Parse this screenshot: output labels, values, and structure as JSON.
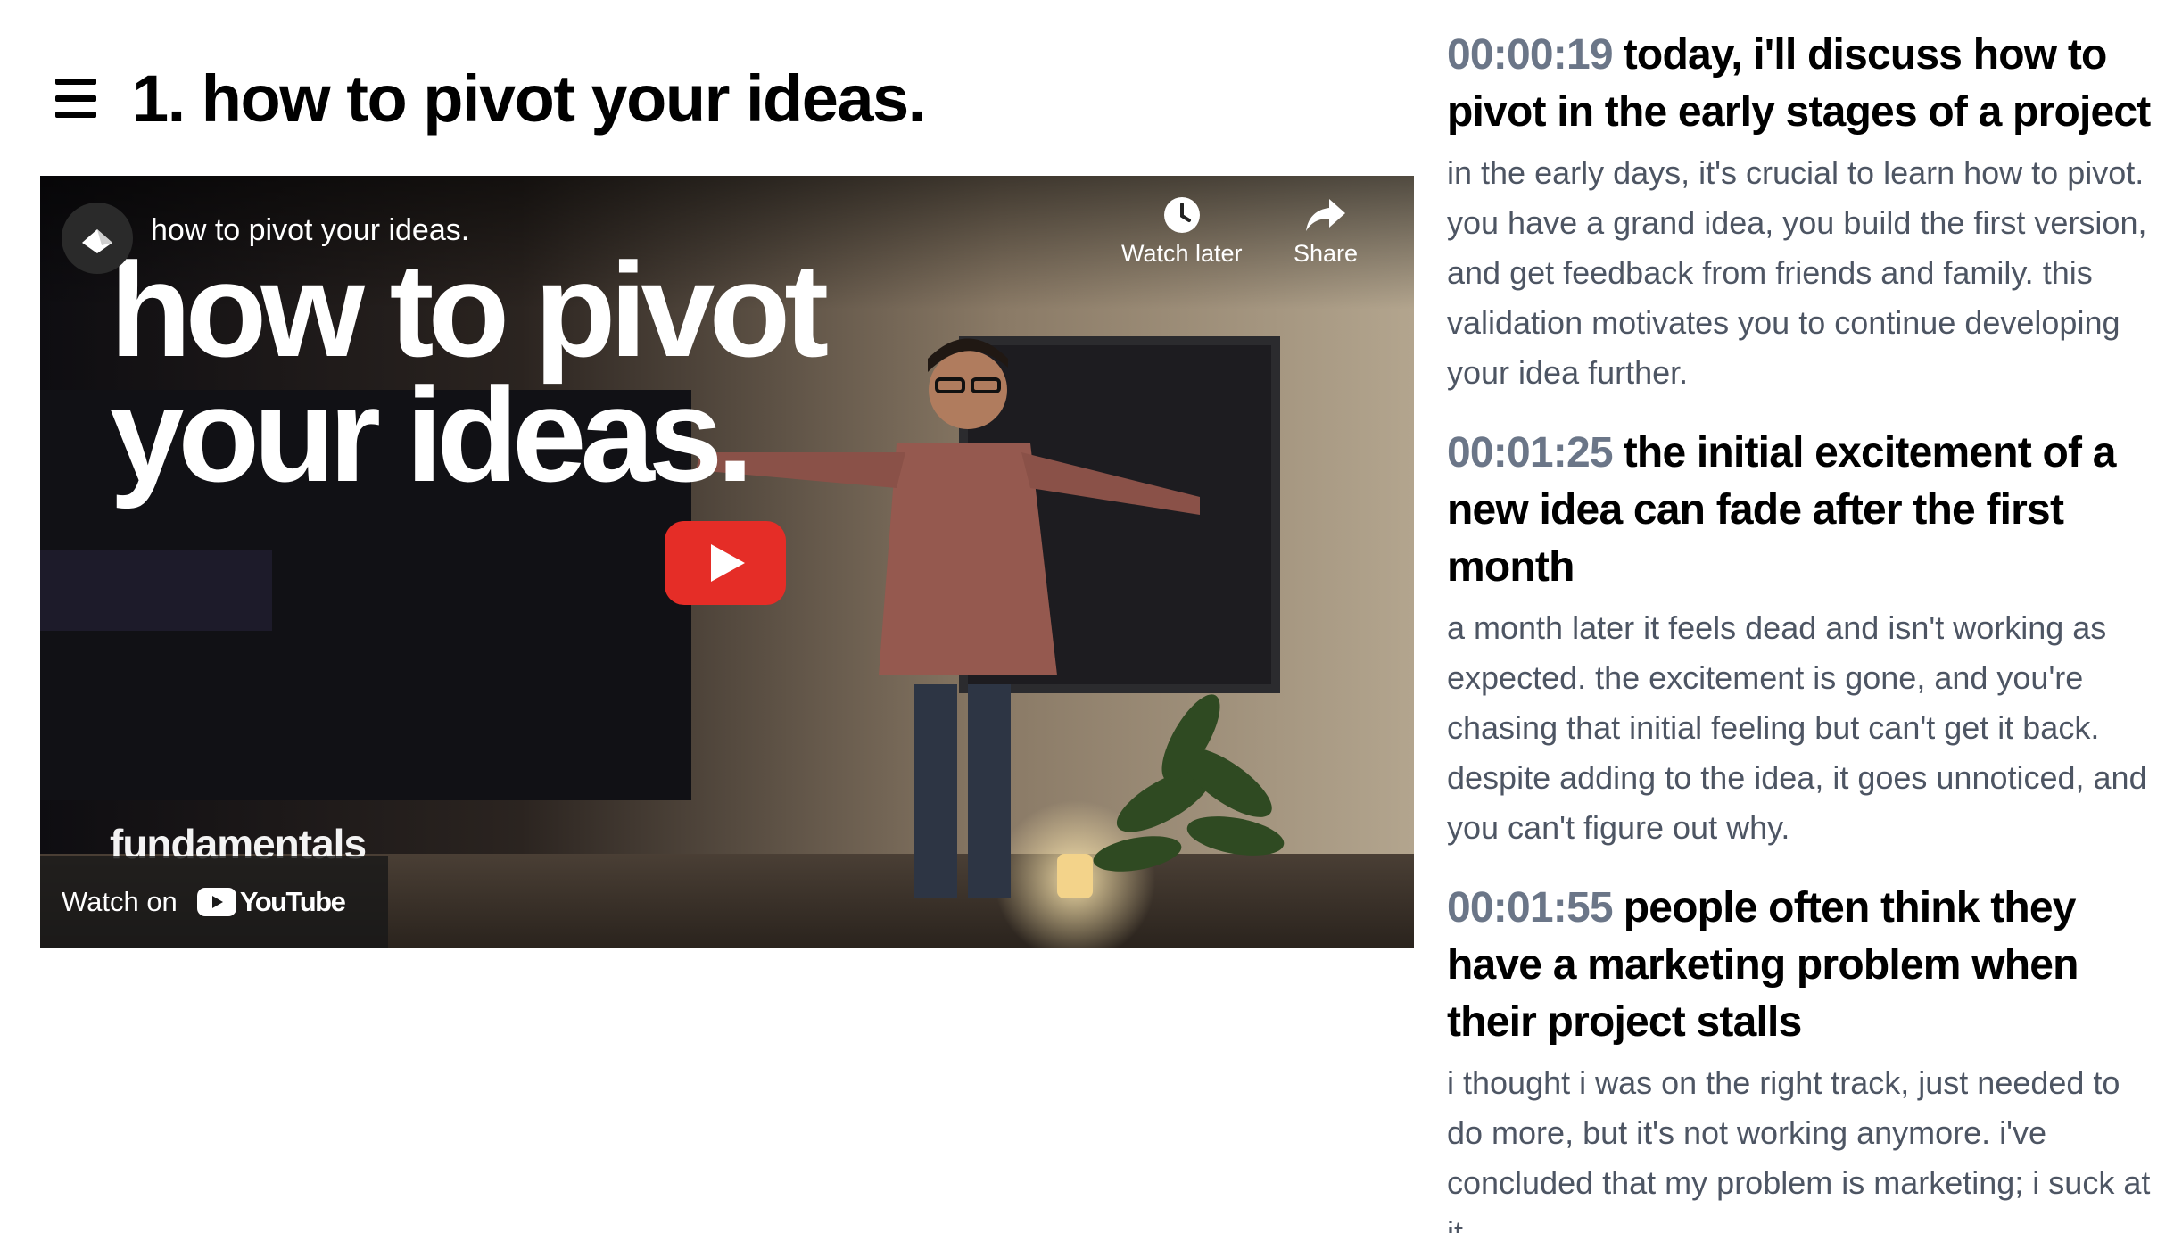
{
  "header": {
    "title": "1. how to pivot your ideas.",
    "menu_icon": "hamburger-menu-icon"
  },
  "video": {
    "title": "how to pivot your ideas.",
    "thumbnail_heading_line1": "how to pivot",
    "thumbnail_heading_line2": "your ideas.",
    "watch_later_label": "Watch later",
    "share_label": "Share",
    "channel_tag": "fundamentals",
    "watch_on_label": "Watch on",
    "youtube_wordmark": "YouTube",
    "play_button_color": "#e52d27"
  },
  "transcript": {
    "timestamp_color": "#6b7688",
    "sections": [
      {
        "time": "00:00:19",
        "heading": "today, i'll discuss how to pivot in the early stages of a project",
        "body": "in the early days, it's crucial to learn how to pivot. you have a grand idea, you build the first version, and get feedback from friends and family. this validation motivates you to continue developing your idea further."
      },
      {
        "time": "00:01:25",
        "heading": "the initial excitement of a new idea can fade after the first month",
        "body": "a month later it feels dead and isn't working as expected. the excitement is gone, and you're chasing that initial feeling but can't get it back. despite adding to the idea, it goes unnoticed, and you can't figure out why."
      },
      {
        "time": "00:01:55",
        "heading": "people often think they have a marketing problem when their project stalls",
        "body": "i thought i was on the right track, just needed to do more, but it's not working anymore. i've concluded that my problem is marketing; i suck at it"
      }
    ]
  }
}
